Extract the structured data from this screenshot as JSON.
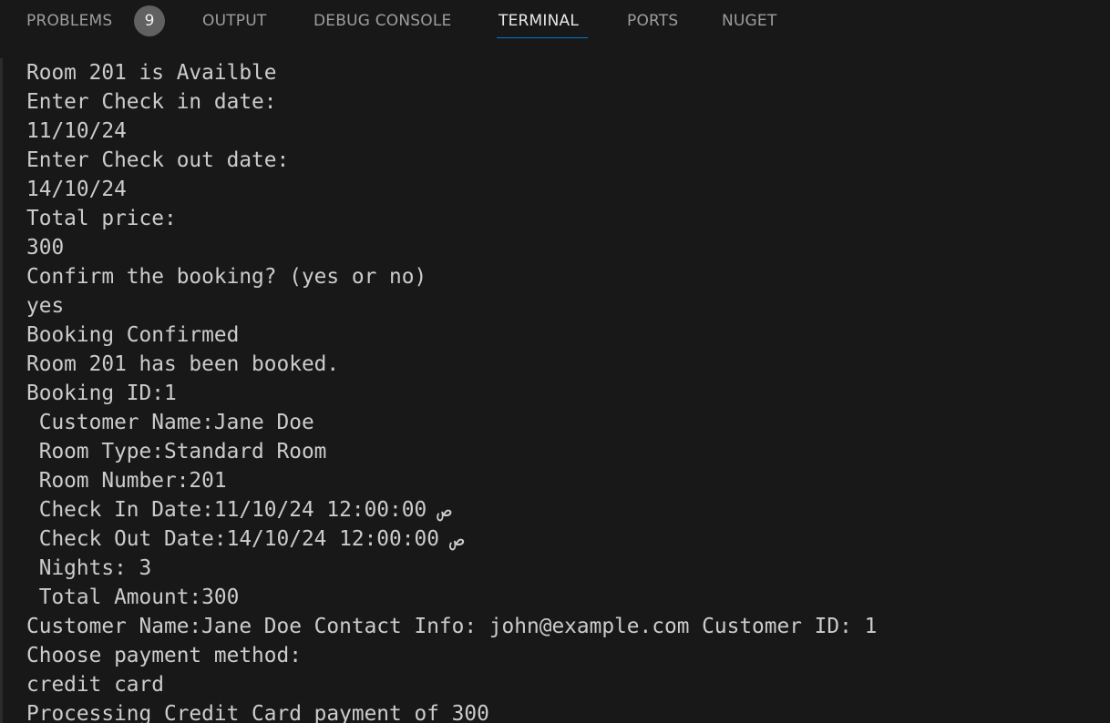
{
  "panel": {
    "tabs": [
      {
        "label": "PROBLEMS",
        "badge": "9"
      },
      {
        "label": "OUTPUT"
      },
      {
        "label": "DEBUG CONSOLE"
      },
      {
        "label": "TERMINAL"
      },
      {
        "label": "PORTS"
      },
      {
        "label": "NUGET"
      }
    ],
    "active_tab": "TERMINAL"
  },
  "terminal": {
    "lines": [
      "Room 201 is Availble",
      "Enter Check in date:",
      "11/10/24",
      "Enter Check out date:",
      "14/10/24",
      "Total price:",
      "300",
      "Confirm the booking? (yes or no)",
      "yes",
      "Booking Confirmed",
      "Room 201 has been booked.",
      "Booking ID:1",
      " Customer Name:Jane Doe",
      " Room Type:Standard Room",
      " Room Number:201",
      " Check In Date:11/10/24 12:00:00 ص",
      " Check Out Date:14/10/24 12:00:00 ص",
      " Nights: 3",
      " Total Amount:300",
      "Customer Name:Jane Doe Contact Info: john@example.com Customer ID: 1",
      "Choose payment method:",
      "credit card",
      "Processing Credit Card payment of 300"
    ]
  }
}
